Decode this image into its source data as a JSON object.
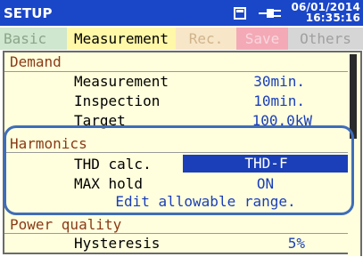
{
  "titlebar": {
    "title": "SETUP",
    "date": "06/01/2014",
    "time": "16:35:16",
    "icons": [
      "card-icon",
      "plug-icon"
    ]
  },
  "tabs": [
    {
      "label": "Basic",
      "active": false
    },
    {
      "label": "Measurement",
      "active": true
    },
    {
      "label": "Rec.",
      "active": false
    },
    {
      "label": "Save",
      "active": false
    },
    {
      "label": "Others",
      "active": false
    }
  ],
  "demand": {
    "title": "Demand",
    "rows": [
      {
        "label": "Measurement",
        "value": "30min."
      },
      {
        "label": "Inspection",
        "value": "10min."
      },
      {
        "label": "Target",
        "value": "100.0kW"
      }
    ]
  },
  "harmonics": {
    "title": "Harmonics",
    "thd": {
      "label": "THD calc.",
      "value": "THD-F"
    },
    "maxhold": {
      "label": "MAX hold",
      "value": "ON"
    },
    "action": "Edit allowable range."
  },
  "power_quality": {
    "title": "Power quality",
    "rows": [
      {
        "label": "Hysteresis",
        "value": "5%"
      }
    ]
  },
  "colors": {
    "titlebar": "#1a46c8",
    "highlight_outline": "#3f6db8",
    "value_text": "#1a3fb8",
    "panel_bg": "#ffffde"
  }
}
